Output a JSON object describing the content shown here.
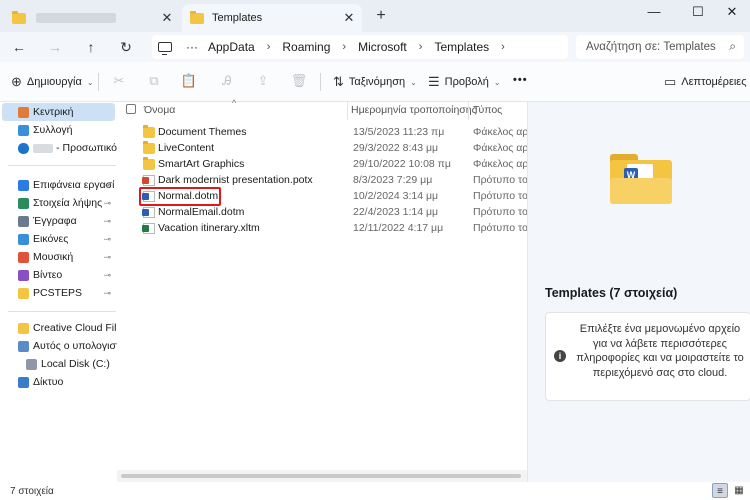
{
  "window": {
    "tabs": [
      {
        "label": "",
        "active": false
      },
      {
        "label": "Templates",
        "active": true
      }
    ],
    "new_tab_glyph": "+",
    "close_glyph": "✕",
    "controls": {
      "minimize": "—",
      "maximize": "☐",
      "close": "✕"
    }
  },
  "address": {
    "back": "←",
    "forward": "→",
    "up": "↑",
    "refresh": "↻",
    "more": "···",
    "crumbs": [
      "AppData",
      "Roaming",
      "Microsoft",
      "Templates"
    ],
    "separator": "›",
    "search_placeholder": "Αναζήτηση σε: Templates",
    "search_glyph": "⌕"
  },
  "commands": {
    "new_label": "Δημιουργία",
    "new_glyph": "⊕",
    "sort_label": "Ταξινόμηση",
    "sort_glyph": "⇅",
    "view_label": "Προβολή",
    "view_glyph": "☰",
    "more_glyph": "•••",
    "details_label": "Λεπτομέρειες",
    "details_glyph": "▭",
    "chevron": "⌄",
    "icons": {
      "cut": "✂",
      "copy": "⧉",
      "paste": "📋",
      "rename": "Ꭿ",
      "share": "⇪",
      "delete": "🗑"
    }
  },
  "nav": {
    "home": "Κεντρική",
    "gallery": "Συλλογή",
    "onedrive": "- Προσωπικό",
    "quick": [
      {
        "label": "Επιφάνεια εργασί",
        "color": "#2c7be5"
      },
      {
        "label": "Στοιχεία λήψης",
        "color": "#2a8c5a"
      },
      {
        "label": "Έγγραφα",
        "color": "#6b7a8f"
      },
      {
        "label": "Εικόνες",
        "color": "#3a8fd9"
      },
      {
        "label": "Μουσική",
        "color": "#e0533a"
      },
      {
        "label": "Βίντεο",
        "color": "#8a4fc4"
      },
      {
        "label": "PCSTEPS",
        "color": "#f4c542"
      }
    ],
    "pin_glyph": "📌",
    "creative_cloud": "Creative Cloud Files P",
    "this_pc": "Αυτός ο υπολογιστή",
    "local_disk": "Local Disk (C:)",
    "network": "Δίκτυο"
  },
  "columns": {
    "name": "Όνομα",
    "date": "Ημερομηνία τροποποίησης",
    "type": "Τύπος",
    "sort_glyph": "^"
  },
  "files": [
    {
      "name": "Document Themes",
      "date": "13/5/2023 11:23 πμ",
      "type": "Φάκελος αρχ",
      "kind": "folder"
    },
    {
      "name": "LiveContent",
      "date": "29/3/2022 8:43 μμ",
      "type": "Φάκελος αρχ",
      "kind": "folder"
    },
    {
      "name": "SmartArt Graphics",
      "date": "29/10/2022 10:08 πμ",
      "type": "Φάκελος αρχ",
      "kind": "folder"
    },
    {
      "name": "Dark modernist presentation.potx",
      "date": "8/3/2023 7:29 μμ",
      "type": "Πρότυπο τοι",
      "kind": "pptx"
    },
    {
      "name": "Normal.dotm",
      "date": "10/2/2024 3:14 μμ",
      "type": "Πρότυπο τοι",
      "kind": "dotm"
    },
    {
      "name": "NormalEmail.dotm",
      "date": "22/4/2023 1:14 μμ",
      "type": "Πρότυπο τοι",
      "kind": "dotm"
    },
    {
      "name": "Vacation itinerary.xltm",
      "date": "12/11/2022 4:17 μμ",
      "type": "Πρότυπο τοι",
      "kind": "xltm"
    }
  ],
  "details_pane": {
    "title": "Templates (7 στοιχεία)",
    "info_text": "Επιλέξτε ένα μεμονωμένο αρχείο για να λάβετε περισσότερες πληροφορίες και να μοιραστείτε το περιεχόμενό σας στο cloud.",
    "info_glyph": "i",
    "folder_mark": "W"
  },
  "status": {
    "count": "7 στοιχεία",
    "details_view_glyph": "≡",
    "tiles_view_glyph": "▦"
  }
}
